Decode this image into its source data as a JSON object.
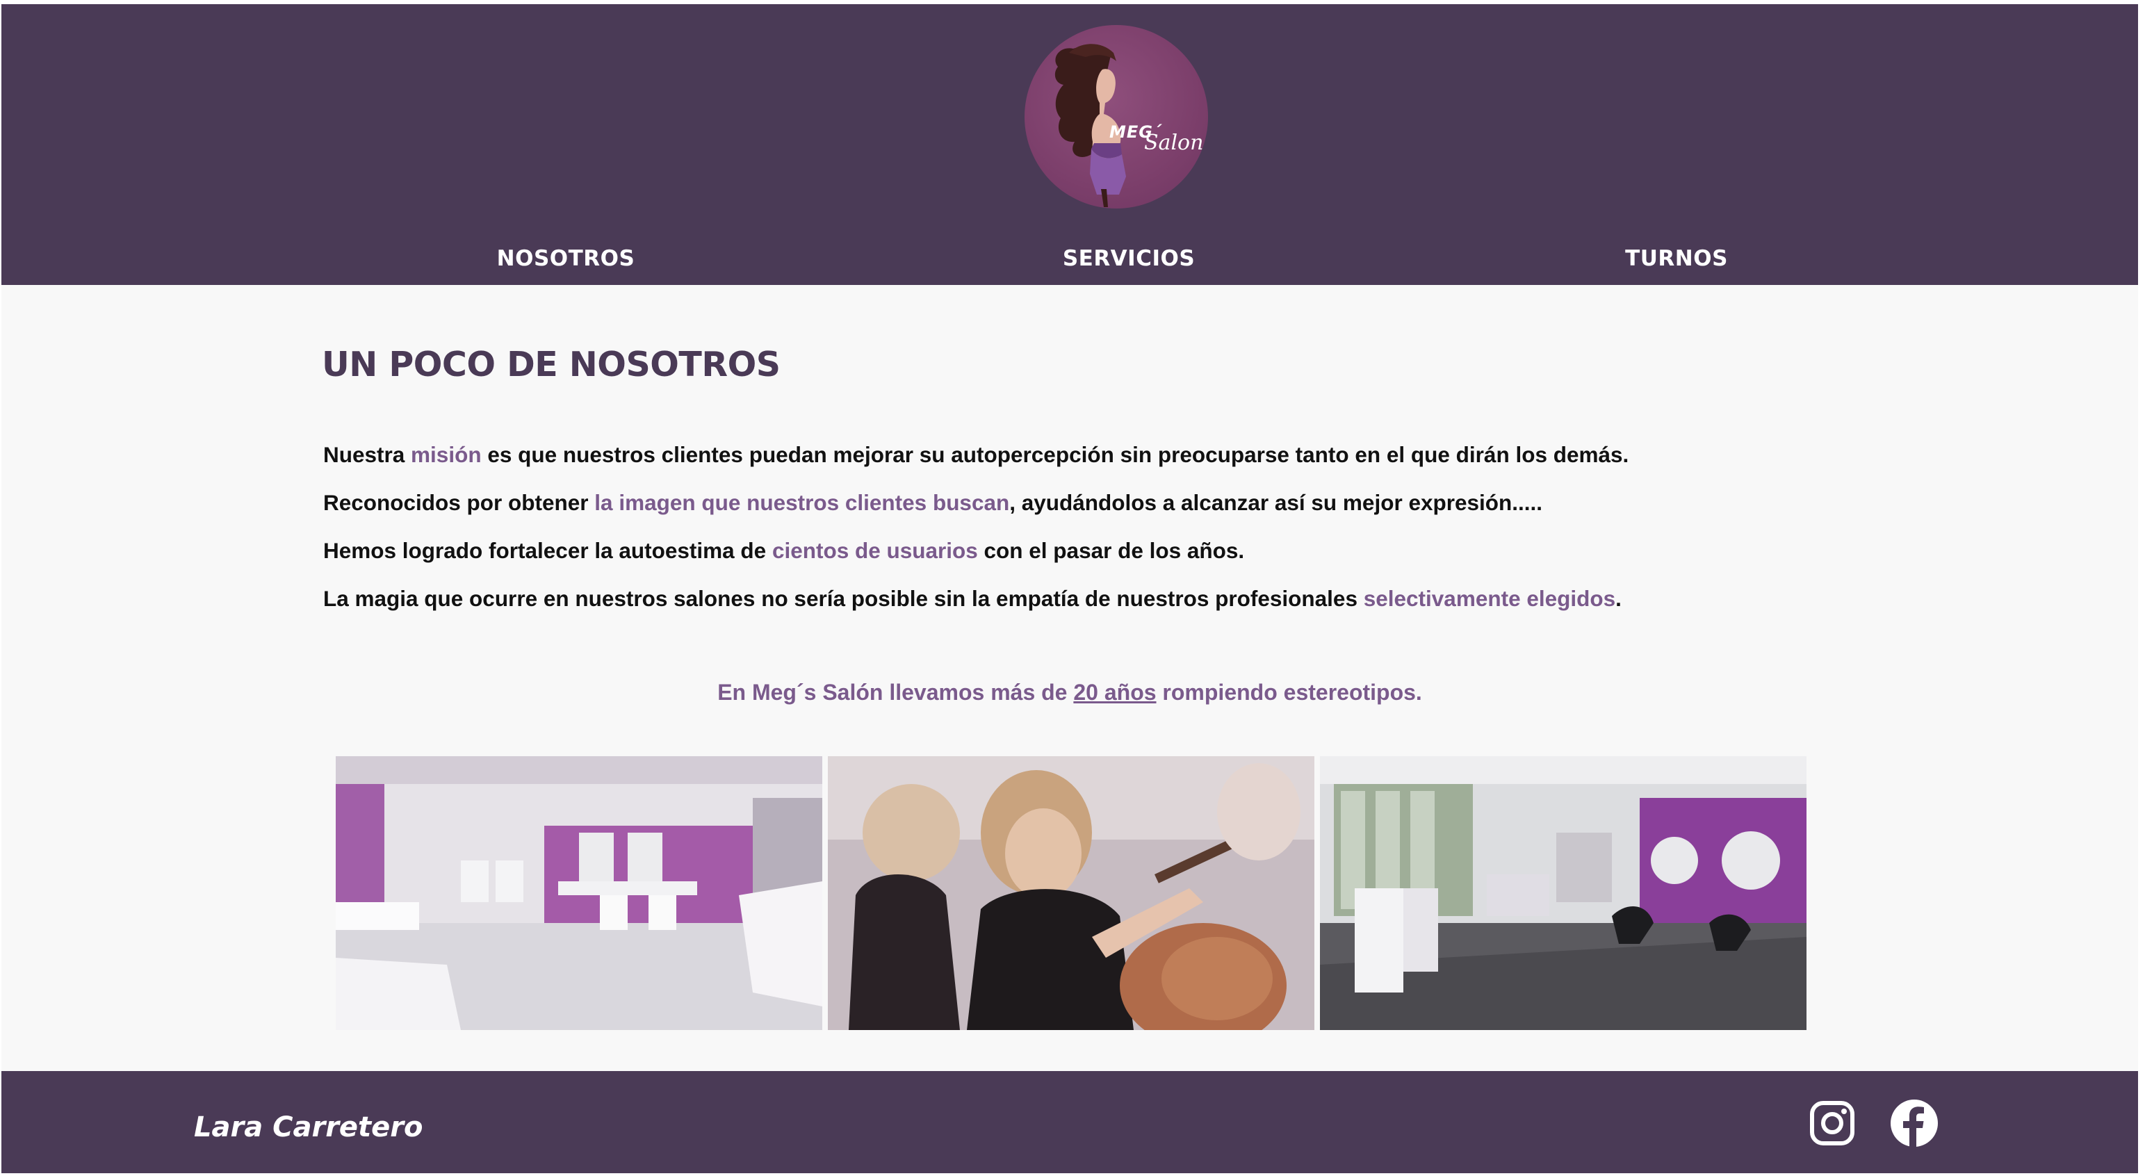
{
  "header": {
    "logo": {
      "icon": "meg-salon-logo",
      "text_main": "MEG´",
      "text_script": "Salon"
    },
    "nav": [
      {
        "label": "NOSOTROS"
      },
      {
        "label": "SERVICIOS"
      },
      {
        "label": "TURNOS"
      }
    ]
  },
  "main": {
    "title": "UN POCO DE NOSOTROS",
    "paragraphs": [
      [
        "Nuestra ",
        "misión",
        " es que nuestros clientes puedan mejorar su autopercepción sin preocuparse tanto en el que dirán los demás."
      ],
      [
        "Reconocidos por  obtener ",
        "la imagen que nuestros clientes buscan",
        ", ayudándolos a alcanzar así su mejor expresión....."
      ],
      [
        "Hemos logrado fortalecer la autoestima de ",
        "cientos de usuarios",
        " con el pasar de los años."
      ],
      [
        "La magia que ocurre en nuestros salones no sería posible sin la empatía de nuestros profesionales ",
        "selectivamente elegidos",
        "."
      ]
    ],
    "tagline": {
      "before": "En Meg´s Salón llevamos más de ",
      "emphasis": "20 años",
      "after": " rompiendo estereotipos."
    },
    "gallery": [
      {
        "icon": "salon-interior-photo"
      },
      {
        "icon": "stylist-curling-hair-photo"
      },
      {
        "icon": "salon-workstations-photo"
      }
    ]
  },
  "footer": {
    "author": "Lara Carretero",
    "social": [
      {
        "icon": "instagram-icon"
      },
      {
        "icon": "facebook-icon"
      }
    ]
  },
  "colors": {
    "brand": "#4a3a56",
    "accent": "#7a5a8c",
    "background": "#f8f8f8",
    "text": "#111111"
  }
}
